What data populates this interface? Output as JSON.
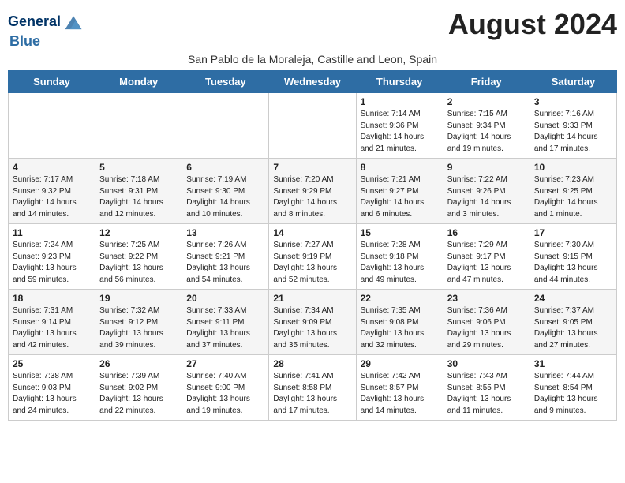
{
  "header": {
    "logo_line1": "General",
    "logo_line2": "Blue",
    "month_title": "August 2024",
    "subtitle": "San Pablo de la Moraleja, Castille and Leon, Spain"
  },
  "days_of_week": [
    "Sunday",
    "Monday",
    "Tuesday",
    "Wednesday",
    "Thursday",
    "Friday",
    "Saturday"
  ],
  "weeks": [
    [
      {
        "day": "",
        "info": ""
      },
      {
        "day": "",
        "info": ""
      },
      {
        "day": "",
        "info": ""
      },
      {
        "day": "",
        "info": ""
      },
      {
        "day": "1",
        "info": "Sunrise: 7:14 AM\nSunset: 9:36 PM\nDaylight: 14 hours\nand 21 minutes."
      },
      {
        "day": "2",
        "info": "Sunrise: 7:15 AM\nSunset: 9:34 PM\nDaylight: 14 hours\nand 19 minutes."
      },
      {
        "day": "3",
        "info": "Sunrise: 7:16 AM\nSunset: 9:33 PM\nDaylight: 14 hours\nand 17 minutes."
      }
    ],
    [
      {
        "day": "4",
        "info": "Sunrise: 7:17 AM\nSunset: 9:32 PM\nDaylight: 14 hours\nand 14 minutes."
      },
      {
        "day": "5",
        "info": "Sunrise: 7:18 AM\nSunset: 9:31 PM\nDaylight: 14 hours\nand 12 minutes."
      },
      {
        "day": "6",
        "info": "Sunrise: 7:19 AM\nSunset: 9:30 PM\nDaylight: 14 hours\nand 10 minutes."
      },
      {
        "day": "7",
        "info": "Sunrise: 7:20 AM\nSunset: 9:29 PM\nDaylight: 14 hours\nand 8 minutes."
      },
      {
        "day": "8",
        "info": "Sunrise: 7:21 AM\nSunset: 9:27 PM\nDaylight: 14 hours\nand 6 minutes."
      },
      {
        "day": "9",
        "info": "Sunrise: 7:22 AM\nSunset: 9:26 PM\nDaylight: 14 hours\nand 3 minutes."
      },
      {
        "day": "10",
        "info": "Sunrise: 7:23 AM\nSunset: 9:25 PM\nDaylight: 14 hours\nand 1 minute."
      }
    ],
    [
      {
        "day": "11",
        "info": "Sunrise: 7:24 AM\nSunset: 9:23 PM\nDaylight: 13 hours\nand 59 minutes."
      },
      {
        "day": "12",
        "info": "Sunrise: 7:25 AM\nSunset: 9:22 PM\nDaylight: 13 hours\nand 56 minutes."
      },
      {
        "day": "13",
        "info": "Sunrise: 7:26 AM\nSunset: 9:21 PM\nDaylight: 13 hours\nand 54 minutes."
      },
      {
        "day": "14",
        "info": "Sunrise: 7:27 AM\nSunset: 9:19 PM\nDaylight: 13 hours\nand 52 minutes."
      },
      {
        "day": "15",
        "info": "Sunrise: 7:28 AM\nSunset: 9:18 PM\nDaylight: 13 hours\nand 49 minutes."
      },
      {
        "day": "16",
        "info": "Sunrise: 7:29 AM\nSunset: 9:17 PM\nDaylight: 13 hours\nand 47 minutes."
      },
      {
        "day": "17",
        "info": "Sunrise: 7:30 AM\nSunset: 9:15 PM\nDaylight: 13 hours\nand 44 minutes."
      }
    ],
    [
      {
        "day": "18",
        "info": "Sunrise: 7:31 AM\nSunset: 9:14 PM\nDaylight: 13 hours\nand 42 minutes."
      },
      {
        "day": "19",
        "info": "Sunrise: 7:32 AM\nSunset: 9:12 PM\nDaylight: 13 hours\nand 39 minutes."
      },
      {
        "day": "20",
        "info": "Sunrise: 7:33 AM\nSunset: 9:11 PM\nDaylight: 13 hours\nand 37 minutes."
      },
      {
        "day": "21",
        "info": "Sunrise: 7:34 AM\nSunset: 9:09 PM\nDaylight: 13 hours\nand 35 minutes."
      },
      {
        "day": "22",
        "info": "Sunrise: 7:35 AM\nSunset: 9:08 PM\nDaylight: 13 hours\nand 32 minutes."
      },
      {
        "day": "23",
        "info": "Sunrise: 7:36 AM\nSunset: 9:06 PM\nDaylight: 13 hours\nand 29 minutes."
      },
      {
        "day": "24",
        "info": "Sunrise: 7:37 AM\nSunset: 9:05 PM\nDaylight: 13 hours\nand 27 minutes."
      }
    ],
    [
      {
        "day": "25",
        "info": "Sunrise: 7:38 AM\nSunset: 9:03 PM\nDaylight: 13 hours\nand 24 minutes."
      },
      {
        "day": "26",
        "info": "Sunrise: 7:39 AM\nSunset: 9:02 PM\nDaylight: 13 hours\nand 22 minutes."
      },
      {
        "day": "27",
        "info": "Sunrise: 7:40 AM\nSunset: 9:00 PM\nDaylight: 13 hours\nand 19 minutes."
      },
      {
        "day": "28",
        "info": "Sunrise: 7:41 AM\nSunset: 8:58 PM\nDaylight: 13 hours\nand 17 minutes."
      },
      {
        "day": "29",
        "info": "Sunrise: 7:42 AM\nSunset: 8:57 PM\nDaylight: 13 hours\nand 14 minutes."
      },
      {
        "day": "30",
        "info": "Sunrise: 7:43 AM\nSunset: 8:55 PM\nDaylight: 13 hours\nand 11 minutes."
      },
      {
        "day": "31",
        "info": "Sunrise: 7:44 AM\nSunset: 8:54 PM\nDaylight: 13 hours\nand 9 minutes."
      }
    ]
  ]
}
